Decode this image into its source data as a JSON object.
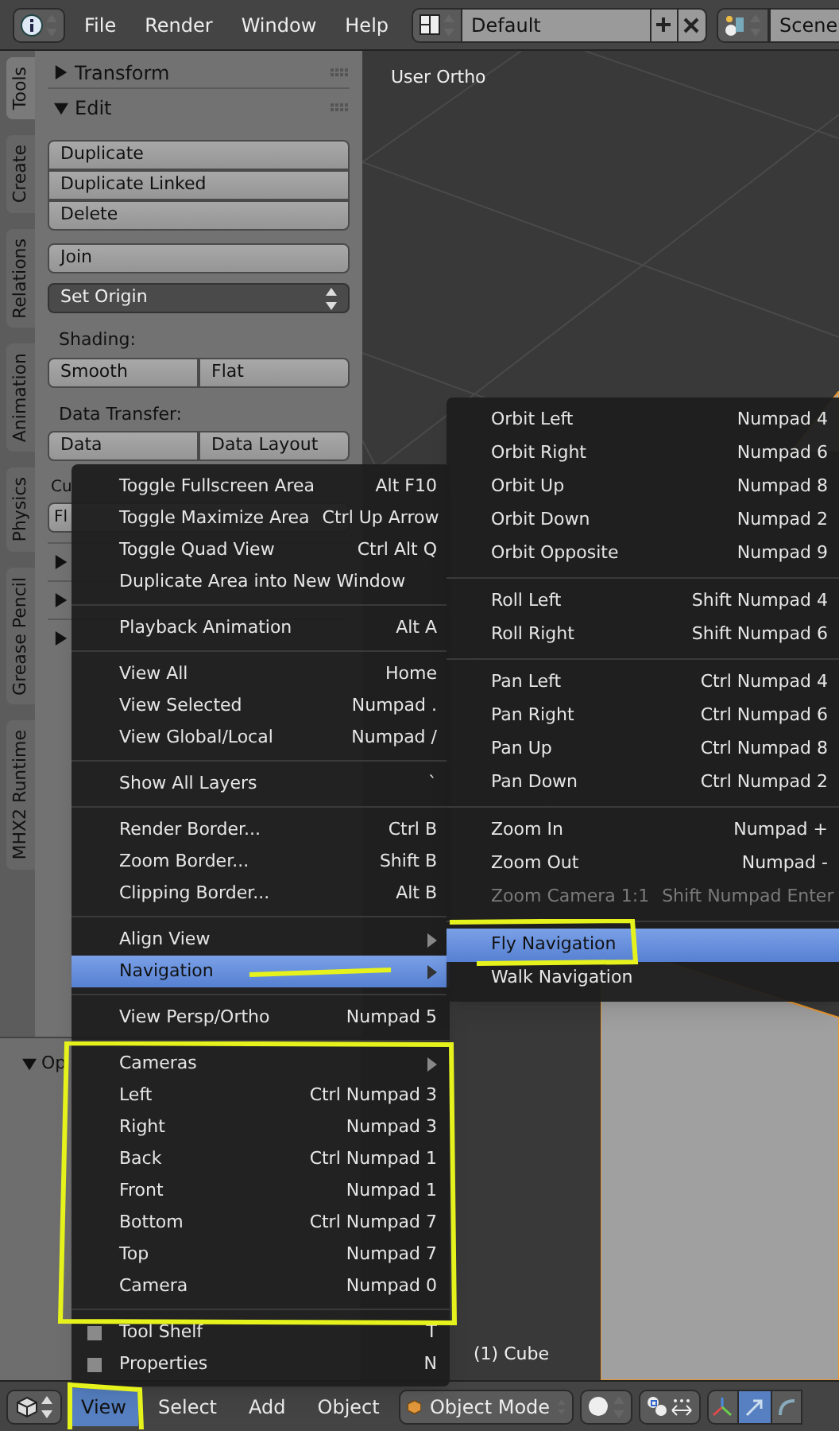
{
  "menu_bar": {
    "items": [
      "File",
      "Render",
      "Window",
      "Help"
    ]
  },
  "screen_layout": {
    "name": "Default"
  },
  "scene": {
    "name": "Scene"
  },
  "tool_tabs": [
    {
      "label": "Tools",
      "selected": true
    },
    {
      "label": "Create",
      "selected": false
    },
    {
      "label": "Relations",
      "selected": false
    },
    {
      "label": "Animation",
      "selected": false
    },
    {
      "label": "Physics",
      "selected": false
    },
    {
      "label": "Grease Pencil",
      "selected": false
    },
    {
      "label": "MHX2 Runtime",
      "selected": false
    }
  ],
  "tool_panel": {
    "transform_header": {
      "title": "Transform",
      "expanded": false
    },
    "edit_header": {
      "title": "Edit",
      "expanded": true
    },
    "button_groups": [
      [
        "Duplicate",
        "Duplicate Linked",
        "Delete"
      ],
      [
        "Join"
      ]
    ],
    "set_origin": "Set Origin",
    "shading": {
      "label": "Shading:",
      "buttons": [
        "Smooth",
        "Flat"
      ]
    },
    "data_transfer": {
      "label": "Data Transfer:",
      "buttons": [
        "Data",
        "Data Layout"
      ]
    },
    "custom_normal_label": "Cu",
    "flip_button": "Fl",
    "collapsed_panels": [
      {
        "expanded": false
      },
      {
        "expanded": false
      },
      {
        "expanded": false
      }
    ]
  },
  "operator_panel": {
    "title": "Op",
    "expanded": true
  },
  "viewport": {
    "view_name": "User Ortho",
    "object_info": "(1) Cube"
  },
  "view_menu": {
    "items": [
      {
        "kind": "item",
        "label": "Toggle Fullscreen Area",
        "shortcut": "Alt F10",
        "selected": false
      },
      {
        "kind": "item",
        "label": "Toggle Maximize Area",
        "shortcut": "Ctrl Up Arrow",
        "selected": false
      },
      {
        "kind": "item",
        "label": "Toggle Quad View",
        "shortcut": "Ctrl Alt Q",
        "selected": false
      },
      {
        "kind": "item",
        "label": "Duplicate Area into New Window",
        "selected": false
      },
      {
        "kind": "separator"
      },
      {
        "kind": "item",
        "label": "Playback Animation",
        "shortcut": "Alt A",
        "selected": false
      },
      {
        "kind": "separator"
      },
      {
        "kind": "item",
        "label": "View All",
        "shortcut": "Home",
        "selected": false
      },
      {
        "kind": "item",
        "label": "View Selected",
        "shortcut": "Numpad .",
        "selected": false
      },
      {
        "kind": "item",
        "label": "View Global/Local",
        "shortcut": "Numpad /",
        "selected": false
      },
      {
        "kind": "separator"
      },
      {
        "kind": "item",
        "label": "Show All Layers",
        "shortcut": "`",
        "selected": false
      },
      {
        "kind": "separator"
      },
      {
        "kind": "item",
        "label": "Render Border...",
        "shortcut": "Ctrl B",
        "selected": false
      },
      {
        "kind": "item",
        "label": "Zoom Border...",
        "shortcut": "Shift B",
        "selected": false
      },
      {
        "kind": "item",
        "label": "Clipping Border...",
        "shortcut": "Alt B",
        "selected": false
      },
      {
        "kind": "separator"
      },
      {
        "kind": "submenu",
        "label": "Align View",
        "selected": false
      },
      {
        "kind": "submenu",
        "label": "Navigation",
        "selected": true
      },
      {
        "kind": "separator"
      },
      {
        "kind": "item",
        "label": "View Persp/Ortho",
        "shortcut": "Numpad 5",
        "selected": false
      },
      {
        "kind": "separator"
      },
      {
        "kind": "submenu",
        "label": "Cameras",
        "selected": false
      },
      {
        "kind": "item",
        "label": "Left",
        "shortcut": "Ctrl Numpad 3",
        "selected": false
      },
      {
        "kind": "item",
        "label": "Right",
        "shortcut": "Numpad 3",
        "selected": false
      },
      {
        "kind": "item",
        "label": "Back",
        "shortcut": "Ctrl Numpad 1",
        "selected": false
      },
      {
        "kind": "item",
        "label": "Front",
        "shortcut": "Numpad 1",
        "selected": false
      },
      {
        "kind": "item",
        "label": "Bottom",
        "shortcut": "Ctrl Numpad 7",
        "selected": false
      },
      {
        "kind": "item",
        "label": "Top",
        "shortcut": "Numpad 7",
        "selected": false
      },
      {
        "kind": "item",
        "label": "Camera",
        "shortcut": "Numpad 0",
        "selected": false
      },
      {
        "kind": "separator"
      },
      {
        "kind": "checkbox",
        "label": "Tool Shelf",
        "shortcut": "T",
        "checked": false,
        "selected": false
      },
      {
        "kind": "checkbox",
        "label": "Properties",
        "shortcut": "N",
        "checked": false,
        "selected": false
      }
    ]
  },
  "navigation_submenu": {
    "items": [
      {
        "kind": "item",
        "label": "Orbit Left",
        "shortcut": "Numpad 4",
        "selected": false,
        "disabled": false
      },
      {
        "kind": "item",
        "label": "Orbit Right",
        "shortcut": "Numpad 6",
        "selected": false,
        "disabled": false
      },
      {
        "kind": "item",
        "label": "Orbit Up",
        "shortcut": "Numpad 8",
        "selected": false,
        "disabled": false
      },
      {
        "kind": "item",
        "label": "Orbit Down",
        "shortcut": "Numpad 2",
        "selected": false,
        "disabled": false
      },
      {
        "kind": "item",
        "label": "Orbit Opposite",
        "shortcut": "Numpad 9",
        "selected": false,
        "disabled": false
      },
      {
        "kind": "separator"
      },
      {
        "kind": "item",
        "label": "Roll Left",
        "shortcut": "Shift Numpad 4",
        "selected": false,
        "disabled": false
      },
      {
        "kind": "item",
        "label": "Roll Right",
        "shortcut": "Shift Numpad 6",
        "selected": false,
        "disabled": false
      },
      {
        "kind": "separator"
      },
      {
        "kind": "item",
        "label": "Pan Left",
        "shortcut": "Ctrl Numpad 4",
        "selected": false,
        "disabled": false
      },
      {
        "kind": "item",
        "label": "Pan Right",
        "shortcut": "Ctrl Numpad 6",
        "selected": false,
        "disabled": false
      },
      {
        "kind": "item",
        "label": "Pan Up",
        "shortcut": "Ctrl Numpad 8",
        "selected": false,
        "disabled": false
      },
      {
        "kind": "item",
        "label": "Pan Down",
        "shortcut": "Ctrl Numpad 2",
        "selected": false,
        "disabled": false
      },
      {
        "kind": "separator"
      },
      {
        "kind": "item",
        "label": "Zoom In",
        "shortcut": "Numpad +",
        "selected": false,
        "disabled": false
      },
      {
        "kind": "item",
        "label": "Zoom Out",
        "shortcut": "Numpad -",
        "selected": false,
        "disabled": false
      },
      {
        "kind": "item",
        "label": "Zoom Camera 1:1",
        "shortcut": "Shift Numpad Enter",
        "selected": false,
        "disabled": true
      },
      {
        "kind": "separator"
      },
      {
        "kind": "item",
        "label": "Fly Navigation",
        "selected": true,
        "disabled": false
      },
      {
        "kind": "item",
        "label": "Walk Navigation",
        "selected": false,
        "disabled": false
      }
    ]
  },
  "bottom_header": {
    "menus": [
      {
        "label": "View",
        "selected": true
      },
      {
        "label": "Select",
        "selected": false
      },
      {
        "label": "Add",
        "selected": false
      },
      {
        "label": "Object",
        "selected": false
      }
    ],
    "mode": "Object Mode"
  }
}
